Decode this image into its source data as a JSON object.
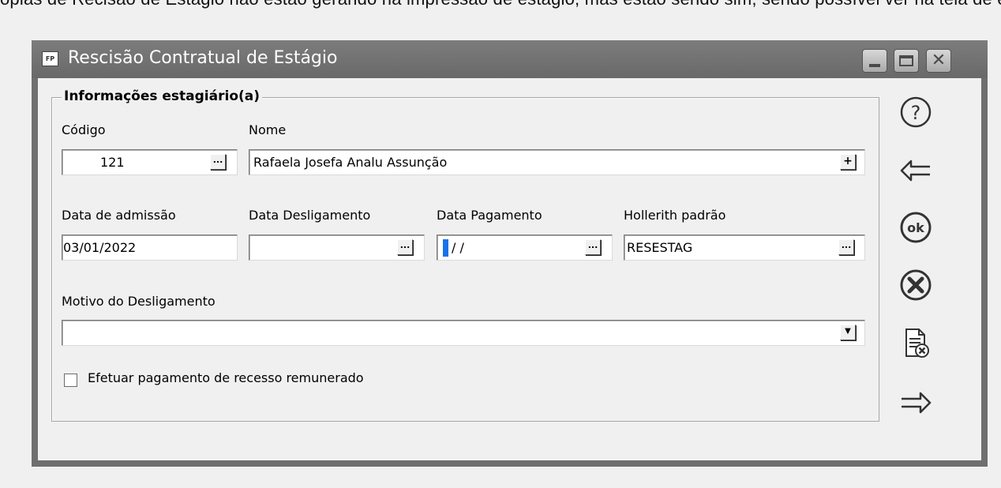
{
  "top_text": "ôpias de Recisão de Estágio não estão gerando na impressão de estágio, mas estão sendo sim, sendo possível ver na tela de estágio e aj",
  "window": {
    "app_icon": "FP",
    "title": "Rescisão Contratual de Estágio",
    "controls": [
      "minimize-icon",
      "maximize-icon",
      "close-icon"
    ]
  },
  "group": {
    "title": "Informações estagiário(a)"
  },
  "form": {
    "codigo": {
      "label": "Código",
      "value": "121"
    },
    "nome": {
      "label": "Nome",
      "value": "Rafaela Josefa Analu Assunção"
    },
    "data_admissao": {
      "label": "Data de admissão",
      "value": "03/01/2022"
    },
    "data_desligamento": {
      "label": "Data Desligamento",
      "value": ""
    },
    "data_pagamento": {
      "label": "Data Pagamento",
      "value": "/ /"
    },
    "hollerith": {
      "label": "Hollerith padrão",
      "value": "RESESTAG"
    },
    "motivo": {
      "label": "Motivo do Desligamento",
      "value": ""
    },
    "recesso": {
      "label": "Efetuar pagamento de recesso remunerado",
      "checked": false
    },
    "ellipsis": "...",
    "plus": "+",
    "dropdown": "▼"
  },
  "side_buttons": [
    "help-icon",
    "back-arrow-icon",
    "ok-icon",
    "cancel-icon",
    "document-delete-icon",
    "forward-arrow-icon"
  ],
  "colors": {
    "titlebar": "#6f6f6f",
    "client": "#f0f0f0",
    "caret": "#1a73e8"
  }
}
